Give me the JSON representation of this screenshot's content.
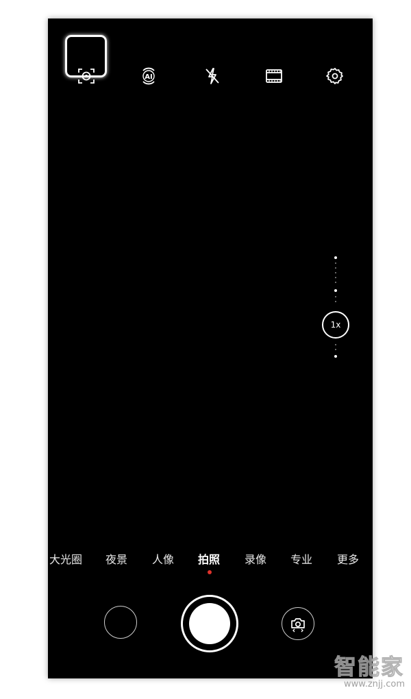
{
  "topbar": {
    "items": [
      {
        "name": "scan-icon"
      },
      {
        "name": "ai-icon",
        "label": "AI"
      },
      {
        "name": "flash-off-icon"
      },
      {
        "name": "aspect-ratio-icon"
      },
      {
        "name": "settings-icon"
      }
    ],
    "highlighted": "scan-icon"
  },
  "zoom": {
    "label": "1x"
  },
  "modes": {
    "items": [
      "大光圈",
      "夜景",
      "人像",
      "拍照",
      "录像",
      "专业",
      "更多"
    ],
    "selected": "拍照"
  },
  "colors": {
    "background": "#000000",
    "accent_indicator": "#e0322b",
    "foreground": "#ffffff"
  },
  "watermark": {
    "chars": "智能家",
    "url": "www.znjj.com"
  }
}
